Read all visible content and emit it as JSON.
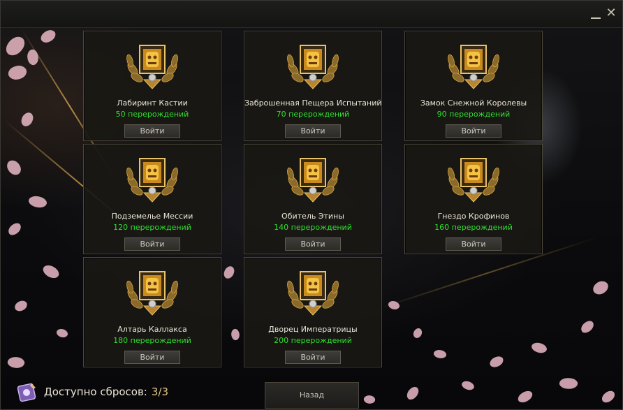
{
  "window": {
    "minimize_symbol": "—",
    "close_symbol": "✕"
  },
  "dungeons": [
    {
      "name": "Лабиринт Кастии",
      "requirement": "50 перерождений",
      "button": "Войти"
    },
    {
      "name": "Заброшенная Пещера Испытаний",
      "requirement": "70 перерождений",
      "button": "Войти"
    },
    {
      "name": "Замок Снежной Королевы",
      "requirement": "90 перерождений",
      "button": "Войти"
    },
    {
      "name": "Подземелье Мессии",
      "requirement": "120 перерождений",
      "button": "Войти"
    },
    {
      "name": "Обитель Этины",
      "requirement": "140 перерождений",
      "button": "Войти"
    },
    {
      "name": "Гнездо Крофинов",
      "requirement": "160 перерождений",
      "button": "Войти"
    },
    {
      "name": "Алтарь Каллакса",
      "requirement": "180 перерождений",
      "button": "Войти"
    },
    {
      "name": "Дворец Императрицы",
      "requirement": "200 перерождений",
      "button": "Войти"
    }
  ],
  "footer": {
    "resets_label": "Доступно сбросов:",
    "resets_count": "3/3",
    "back_button": "Назад"
  },
  "colors": {
    "requirement_text": "#2ee02e",
    "resets_count": "#e3c887",
    "card_border": "#4d483c",
    "petal": "#e9b9c6",
    "gold": "#d9a441"
  },
  "icons": {
    "emblem": "gold-laurel-emblem-icon",
    "resets": "reset-scroll-icon"
  }
}
